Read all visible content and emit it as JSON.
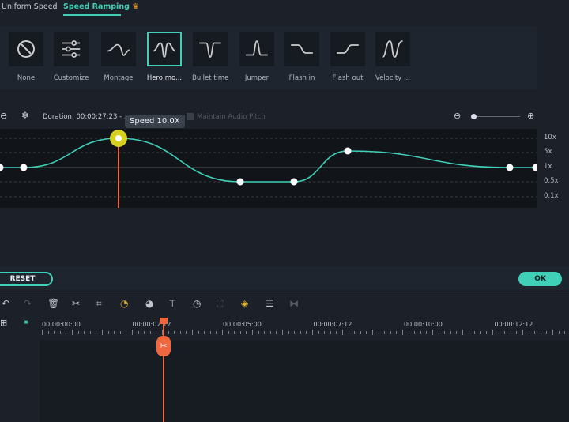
{
  "tabs": [
    {
      "label": "Uniform Speed"
    },
    {
      "label": "Speed Ramping"
    }
  ],
  "presets": [
    {
      "label": "None",
      "icon": "none-icon"
    },
    {
      "label": "Customize",
      "icon": "sliders-icon"
    },
    {
      "label": "Montage",
      "icon": "montage-curve-icon"
    },
    {
      "label": "Hero mo...",
      "icon": "hero-curve-icon",
      "selected": true
    },
    {
      "label": "Bullet time",
      "icon": "bullet-curve-icon"
    },
    {
      "label": "Jumper",
      "icon": "jumper-curve-icon"
    },
    {
      "label": "Flash in",
      "icon": "flash-in-curve-icon"
    },
    {
      "label": "Flash out",
      "icon": "flash-out-curve-icon"
    },
    {
      "label": "Velocity ...",
      "icon": "velocity-curve-icon"
    }
  ],
  "duration": {
    "label": "Duration:",
    "value": "00:00:27:23 - ..."
  },
  "tooltip": "Speed 10.0X",
  "maintain_audio_pitch": "Maintain Audio Pitch",
  "y_labels": [
    "10x",
    "5x",
    "1x",
    "0.5x",
    "0.1x"
  ],
  "buttons": {
    "reset": "RESET",
    "ok": "OK"
  },
  "timecodes": [
    "00:00:00:00",
    "00:00:02:12",
    "00:00:05:00",
    "00:00:07:12",
    "00:00:10:00",
    "00:00:12:12"
  ],
  "colors": {
    "accent": "#3fd0b7",
    "playhead": "#f0663f",
    "crown": "#f0a020"
  }
}
